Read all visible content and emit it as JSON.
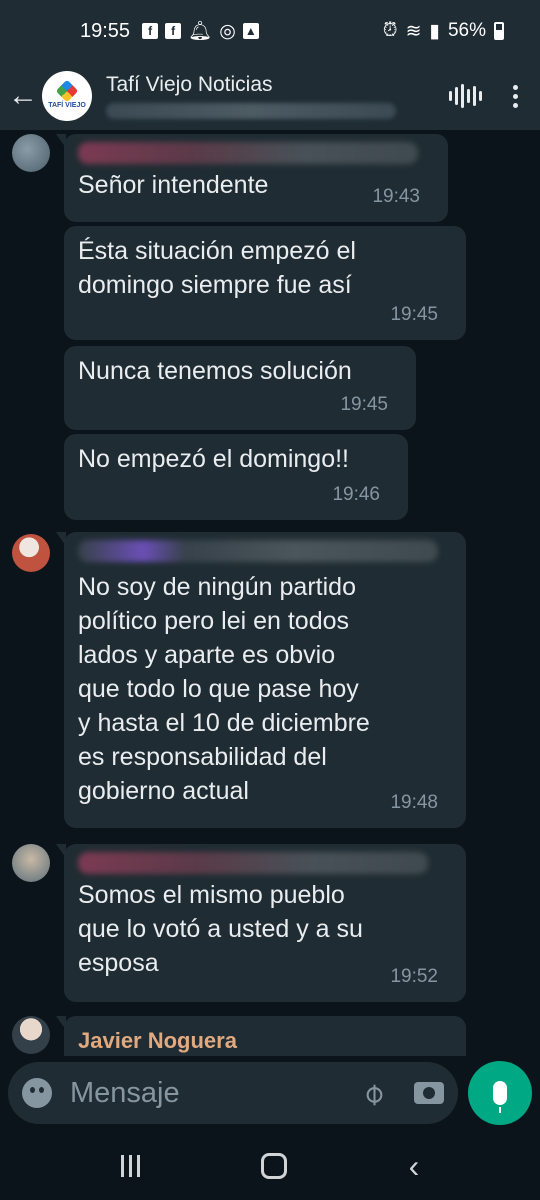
{
  "status_bar": {
    "time": "19:55",
    "battery": "56%",
    "icons": [
      "facebook-icon",
      "facebook-icon",
      "bell-icon",
      "whatsapp-icon",
      "image-icon"
    ]
  },
  "header": {
    "title": "Tafí Viejo Noticias",
    "logo_text": "TAFÍ VIEJO"
  },
  "messages": [
    {
      "text": "Señor intendente",
      "time": "19:43"
    },
    {
      "text": "Ésta situación empezó el\ndomingo siempre fue así",
      "time": "19:45"
    },
    {
      "text": "Nunca tenemos solución",
      "time": "19:45"
    },
    {
      "text": "No empezó el domingo!!",
      "time": "19:46"
    },
    {
      "text": "No soy de ningún partido\npolítico pero lei en todos\nlados y aparte es obvio\nque todo lo que pase hoy\ny hasta el 10 de diciembre\nes responsabilidad del\ngobierno actual",
      "time": "19:48"
    },
    {
      "text": "Somos el mismo pueblo\nque lo votó a usted y a su\nesposa",
      "time": "19:52"
    }
  ],
  "last_sender": "Javier Noguera",
  "input": {
    "placeholder": "Mensaje"
  },
  "colors": {
    "accent": "#00a884",
    "bubble": "#202c33",
    "background": "#0b141a",
    "header": "#1f2c34"
  }
}
